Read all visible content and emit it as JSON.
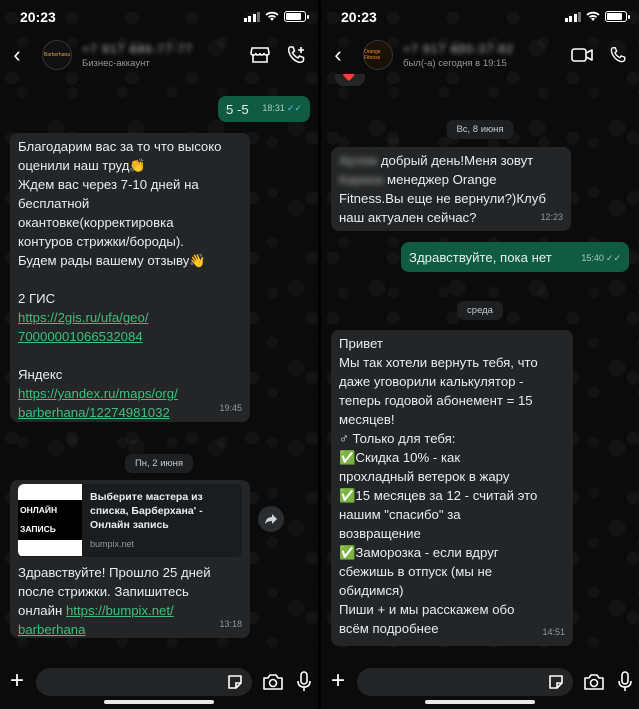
{
  "status_bar": {
    "time": "20:23"
  },
  "left": {
    "header": {
      "contact_name": "+7 917 446-77-77",
      "subtitle": "Бизнес-аккаунт",
      "avatar_text": "Barberhana"
    },
    "messages": {
      "out1": {
        "text": "5 -5",
        "time": "18:31"
      },
      "in1": {
        "lines": [
          "Благодарим вас за то что высоко",
          "оценили наш труд👏",
          "Ждем вас через 7-10 дней  на",
          "бесплатной",
          "окантовке(корректировка",
          "контуров стрижки/бороды).",
          "Будем рады вашему отзыву👋",
          "",
          "2 ГИС"
        ],
        "link1a": "https://2gis.ru/ufa/geo/",
        "link1b": "70000001066532084",
        "yandex_label": "Яндекс",
        "link2a": "https://yandex.ru/maps/org/",
        "link2b": "barberhana/12274981032",
        "time": "19:45"
      },
      "date_pill": "Пн, 2 июня",
      "in2": {
        "preview_image_text": "ОНЛАЙН ЗАПИСЬ",
        "preview_title": "Выберите мастера из списка, Барберхана' - Онлайн запись",
        "preview_domain": "bumpix.net",
        "lines": [
          "Здравствуйте! Прошло 25 дней",
          "после стрижки. Запишитесь"
        ],
        "line3_prefix": "онлайн ",
        "link_a": "https://bumpix.net/",
        "link_b": "barberhana",
        "time": "13:18"
      }
    }
  },
  "right": {
    "header": {
      "contact_name": "+7 917 400-37-82",
      "subtitle": "был(-а) сегодня в 19:15",
      "avatar_text": "Orange Fitness"
    },
    "messages": {
      "heart": "❤️",
      "date_pill1": "Вс, 8 июня",
      "in1": {
        "blur1": "Артем",
        "line1": "добрый день!Меня зовут",
        "blur2": "Карина",
        "line2": "менеджер Orange",
        "lines": [
          "Fitness.Вы еще не вернули?)Клуб",
          "наш актуален сейчас?"
        ],
        "time": "12:23"
      },
      "out1": {
        "text": "Здравствуйте, пока нет",
        "time": "15:40"
      },
      "date_pill2": "среда",
      "in2": {
        "lines": [
          "Привет",
          "Мы так хотели вернуть тебя, что",
          "даже уговорили калькулятор -",
          "теперь годовой абонемент = 15",
          "месяцев!",
          "♂ Только для тебя:",
          "✅Скидка 10% - как",
          "прохладный ветерок в жару",
          "✅15 месяцев за 12 - считай это",
          "нашим \"спасибо\" за",
          "возвращение",
          "✅Заморозка - если вдруг",
          "сбежишь в отпуск (мы не",
          "обидимся)",
          "Пиши + и мы расскажем обо",
          "всём подробнее"
        ],
        "time": "14:51"
      }
    }
  },
  "colors": {
    "incoming_bubble": "#232526",
    "outgoing_bubble": "#0f5c43",
    "link": "#3fbf7f",
    "read_ticks": "#53bdeb"
  },
  "icons": [
    "back-chevron-icon",
    "shop-icon",
    "add-call-icon",
    "video-call-icon",
    "phone-icon",
    "plus-icon",
    "sticker-icon",
    "camera-icon",
    "microphone-icon",
    "forward-icon"
  ]
}
